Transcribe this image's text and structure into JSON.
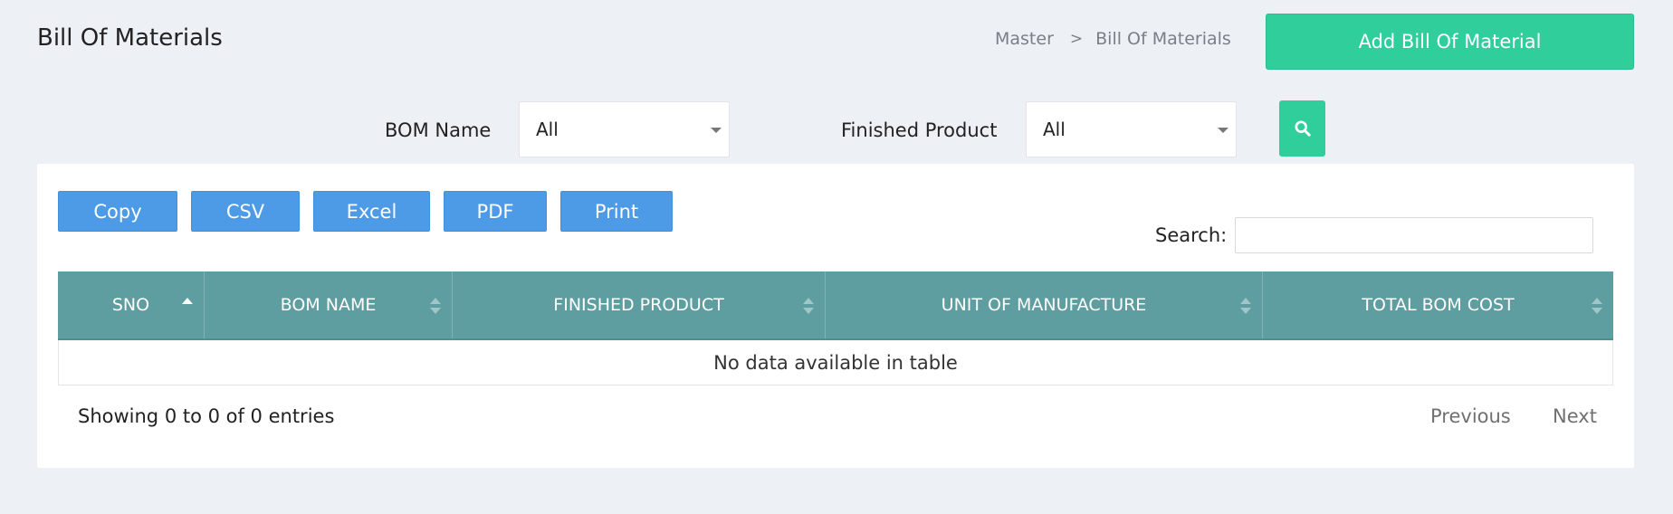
{
  "header": {
    "title": "Bill Of Materials",
    "breadcrumb": [
      "Master",
      "Bill Of Materials"
    ],
    "breadcrumb_separator": ">",
    "add_button_label": "Add Bill Of Material"
  },
  "filters": {
    "bom_name_label": "BOM Name",
    "bom_name_value": "All",
    "finished_product_label": "Finished Product",
    "finished_product_value": "All",
    "search_icon": "search-icon"
  },
  "export_buttons": [
    "Copy",
    "CSV",
    "Excel",
    "PDF",
    "Print"
  ],
  "table_search": {
    "label": "Search:",
    "value": "",
    "placeholder": ""
  },
  "table": {
    "columns": [
      "SNO",
      "BOM NAME",
      "FINISHED PRODUCT",
      "UNIT OF MANUFACTURE",
      "TOTAL BOM COST"
    ],
    "sorted_column": "SNO",
    "sort_direction": "ascending",
    "empty_message": "No data available in table",
    "rows": []
  },
  "footer": {
    "info": "Showing 0 to 0 of 0 entries",
    "previous_label": "Previous",
    "next_label": "Next"
  },
  "colors": {
    "accent_green": "#2fce9b",
    "export_blue": "#4d9be6",
    "table_header": "#5f9ea0",
    "background": "#edf0f5"
  }
}
